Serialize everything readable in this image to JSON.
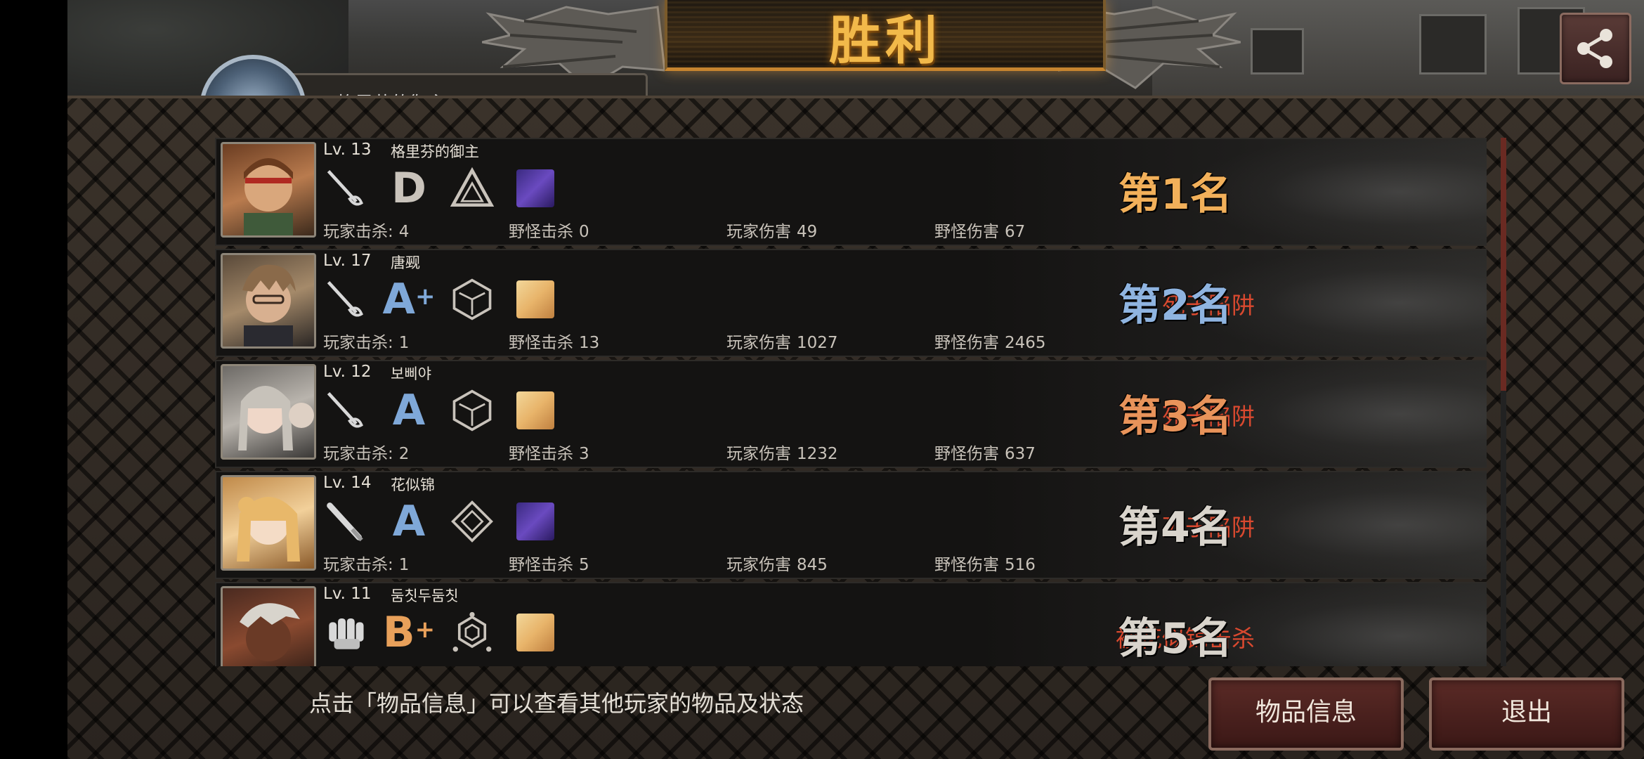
{
  "header": {
    "title": "胜利",
    "self_name": "格里芬的御主",
    "share_icon": "share-icon"
  },
  "players": [
    {
      "level": "Lv. 13",
      "name": "格里芬的御主",
      "weapon": "rapier-icon",
      "grade": "D",
      "grade_plus": "",
      "death": "",
      "rank": "第1名",
      "rank_color": "#f2b05a",
      "stats": {
        "player_kills_label": "玩家击杀:",
        "player_kills": "4",
        "monster_kills_label": "野怪击杀",
        "monster_kills": "0",
        "player_damage_label": "玩家伤害",
        "player_damage": "49",
        "monster_damage_label": "野怪伤害",
        "monster_damage": "67"
      }
    },
    {
      "level": "Lv. 17",
      "name": "唐觋",
      "weapon": "rapier-icon",
      "grade": "A",
      "grade_plus": "+",
      "death": "死于陷阱",
      "rank": "第2名",
      "rank_color": "#8fb4e0",
      "stats": {
        "player_kills_label": "玩家击杀:",
        "player_kills": "1",
        "monster_kills_label": "野怪击杀",
        "monster_kills": "13",
        "player_damage_label": "玩家伤害",
        "player_damage": "1027",
        "monster_damage_label": "野怪伤害",
        "monster_damage": "2465"
      }
    },
    {
      "level": "Lv. 12",
      "name": "보삐야",
      "weapon": "rapier-icon",
      "grade": "A",
      "grade_plus": "",
      "death": "死于陷阱",
      "rank": "第3名",
      "rank_color": "#e8935a",
      "stats": {
        "player_kills_label": "玩家击杀:",
        "player_kills": "2",
        "monster_kills_label": "野怪击杀",
        "monster_kills": "3",
        "player_damage_label": "玩家伤害",
        "player_damage": "1232",
        "monster_damage_label": "野怪伤害",
        "monster_damage": "637"
      }
    },
    {
      "level": "Lv. 14",
      "name": "花似锦",
      "weapon": "bat-icon",
      "grade": "A",
      "grade_plus": "",
      "death": "死于陷阱",
      "rank": "第4名",
      "rank_color": "#d9d4cc",
      "stats": {
        "player_kills_label": "玩家击杀:",
        "player_kills": "1",
        "monster_kills_label": "野怪击杀",
        "monster_kills": "5",
        "player_damage_label": "玩家伤害",
        "player_damage": "845",
        "monster_damage_label": "野怪伤害",
        "monster_damage": "516"
      }
    },
    {
      "level": "Lv. 11",
      "name": "둠칫두둠칫",
      "weapon": "glove-icon",
      "grade": "B",
      "grade_plus": "+",
      "death": "被花似锦击杀",
      "rank": "第5名",
      "rank_color": "#d9d4cc",
      "stats": {
        "player_kills_label": "",
        "player_kills": "",
        "monster_kills_label": "",
        "monster_kills": "",
        "player_damage_label": "",
        "player_damage": "",
        "monster_damage_label": "",
        "monster_damage": ""
      }
    }
  ],
  "footer": {
    "hint": "点击「物品信息」可以查看其他玩家的物品及状态",
    "item_info_label": "物品信息",
    "exit_label": "退出"
  },
  "colors": {
    "grade_blue": "#7fa8d8",
    "grade_gray": "#c9c3bb",
    "grade_orange": "#e8a05a",
    "death_red": "#d9492f"
  }
}
